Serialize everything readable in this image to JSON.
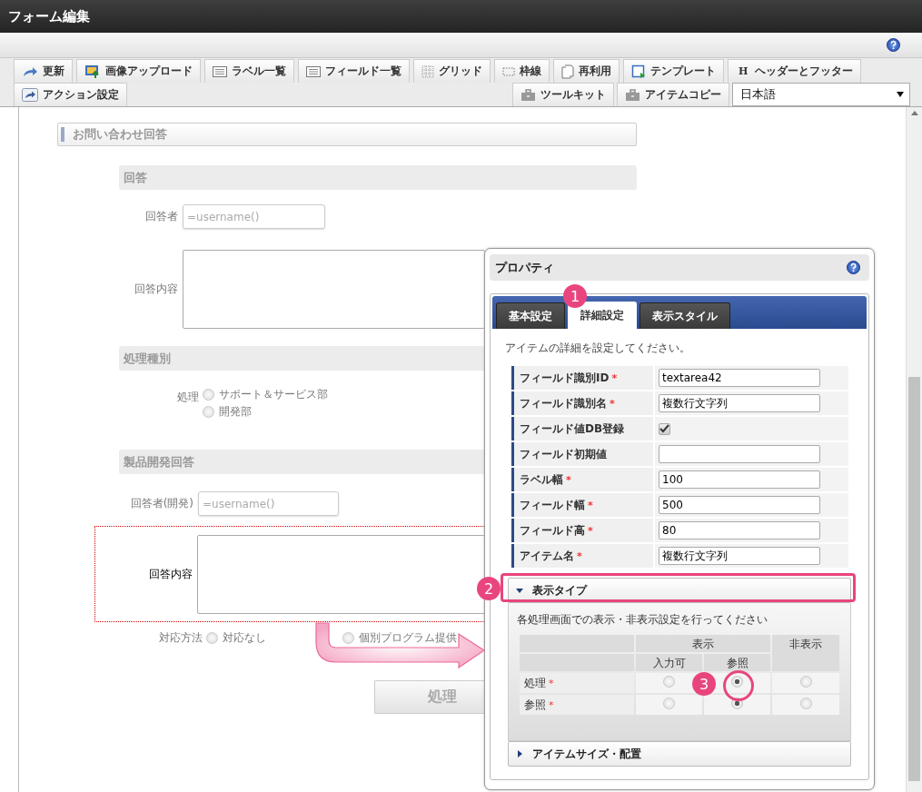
{
  "window": {
    "title": "フォーム編集"
  },
  "toolbar": {
    "primary": [
      {
        "label": "更新",
        "kind": "refresh"
      },
      {
        "label": "画像アップロード",
        "kind": "image"
      },
      {
        "label": "ラベル一覧",
        "kind": "list"
      },
      {
        "label": "フィールド一覧",
        "kind": "list"
      },
      {
        "label": "グリッド",
        "kind": "grid"
      },
      {
        "label": "枠線",
        "kind": "frame"
      },
      {
        "label": "再利用",
        "kind": "document"
      },
      {
        "label": "テンプレート",
        "kind": "template"
      },
      {
        "label": "ヘッダーとフッター",
        "kind": "letter",
        "icon_text": "H"
      }
    ],
    "secondary_left": [
      {
        "label": "アクション設定",
        "kind": "share"
      }
    ],
    "secondary_right": [
      {
        "label": "ツールキット",
        "kind": "briefcase"
      },
      {
        "label": "アイテムコピー",
        "kind": "briefcase"
      }
    ],
    "language": {
      "value": "日本語"
    }
  },
  "form": {
    "title": "お問い合わせ回答",
    "groups": [
      {
        "title": "回答",
        "fields": [
          {
            "kind": "input",
            "label": "回答者",
            "placeholder": "=username()"
          },
          {
            "kind": "textarea",
            "label": "回答内容",
            "selected": false
          }
        ]
      },
      {
        "title": "処理種別",
        "fields": [
          {
            "kind": "radio",
            "label": "処理",
            "options": [
              {
                "label": "サポート＆サービス部",
                "selected": false
              },
              {
                "label": "開発部",
                "selected": false
              }
            ]
          }
        ]
      },
      {
        "title": "製品開発回答",
        "fields": [
          {
            "kind": "input",
            "label": "回答者(開発)",
            "placeholder": "=username()"
          },
          {
            "kind": "textarea",
            "label": "回答内容",
            "selected": true
          },
          {
            "kind": "radio-inline",
            "label": "対応方法",
            "options": [
              {
                "label": "対応なし",
                "selected": false
              },
              {
                "label": "個別プログラム提供",
                "selected": false
              }
            ]
          }
        ]
      }
    ],
    "button": "処理"
  },
  "panel": {
    "title": "プロパティ",
    "tabs": [
      {
        "label": "基本設定",
        "selected": false
      },
      {
        "label": "詳細設定",
        "selected": true
      },
      {
        "label": "表示スタイル",
        "selected": false
      }
    ],
    "description": "アイテムの詳細を設定してください。",
    "properties": [
      {
        "kind": "text",
        "label": "フィールド識別ID",
        "mark": "*",
        "value": "textarea42"
      },
      {
        "kind": "text",
        "label": "フィールド識別名",
        "mark": "*",
        "value": "複数行文字列"
      },
      {
        "kind": "checkbox",
        "label": "フィールド値DB登録",
        "checked": true
      },
      {
        "kind": "text",
        "label": "フィールド初期値"
      },
      {
        "kind": "text",
        "label": "ラベル幅",
        "mark": "*",
        "value": "100"
      },
      {
        "kind": "text",
        "label": "フィールド幅",
        "mark": "*",
        "value": "500"
      },
      {
        "kind": "text",
        "label": "フィールド高",
        "mark": "*",
        "value": "80"
      },
      {
        "kind": "text",
        "label": "アイテム名",
        "mark": "*",
        "value": "複数行文字列"
      }
    ],
    "sections": [
      {
        "title": "表示タイプ",
        "expanded": true,
        "description": "各処理画面での表示・非表示設定を行ってください",
        "matrix": {
          "group": "表示",
          "columns": [
            "入力可",
            "参照"
          ],
          "hidden": "非表示",
          "rows": [
            {
              "label": "処理",
              "mark": "*",
              "options": [
                {
                  "selected": false
                },
                {
                  "selected": true
                },
                {
                  "selected": false
                }
              ]
            },
            {
              "label": "参照",
              "mark": "*",
              "options": [
                {
                  "selected": false
                },
                {
                  "selected": true
                },
                {
                  "selected": false
                }
              ]
            }
          ]
        }
      },
      {
        "title": "アイテムサイズ・配置",
        "expanded": false
      }
    ]
  },
  "annotations": {
    "badges": [
      {
        "text": "1"
      },
      {
        "text": "2"
      },
      {
        "text": "3"
      }
    ]
  }
}
